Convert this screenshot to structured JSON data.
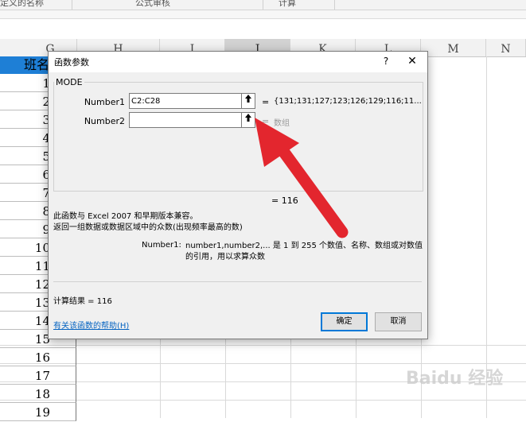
{
  "ribbon": {
    "groups": [
      "定义的名称",
      "公式审核",
      "计算"
    ]
  },
  "spreadsheet": {
    "columns": [
      "G",
      "H",
      "I",
      "J",
      "K",
      "L",
      "M",
      "N"
    ],
    "selected_column": "J",
    "header_cell": "班名",
    "row_numbers": [
      "1",
      "2",
      "3",
      "4",
      "5",
      "6",
      "7",
      "8",
      "9",
      "10",
      "11",
      "12",
      "13",
      "14",
      "15",
      "16",
      "17",
      "18",
      "19"
    ]
  },
  "dialog": {
    "title": "函数参数",
    "help_glyph": "?",
    "close_glyph": "✕",
    "function_name": "MODE",
    "args": [
      {
        "label": "Number1",
        "value": "C2:C28",
        "result": "{131;131;127;123;126;129;116;11..."
      },
      {
        "label": "Number2",
        "value": "",
        "result": "数组"
      }
    ],
    "equals": "=",
    "collapse_glyph": "🠕",
    "formula_result": "= 116",
    "description_line1": "此函数与 Excel 2007 和早期版本兼容。",
    "description_line2": "返回一组数据或数据区域中的众数(出现频率最高的数)",
    "arg_help_name": "Number1:",
    "arg_help_text": "number1,number2,... 是 1 到 255 个数值、名称、数组或对数值的引用，用以求算众数",
    "calc_result": "计算结果 =   116",
    "help_link": "有关该函数的帮助(H)",
    "ok_label": "确定",
    "cancel_label": "取消"
  },
  "watermark": "Baidu 经验",
  "colors": {
    "selected_header": "#1e7fd6",
    "arrow": "#e3262e"
  }
}
